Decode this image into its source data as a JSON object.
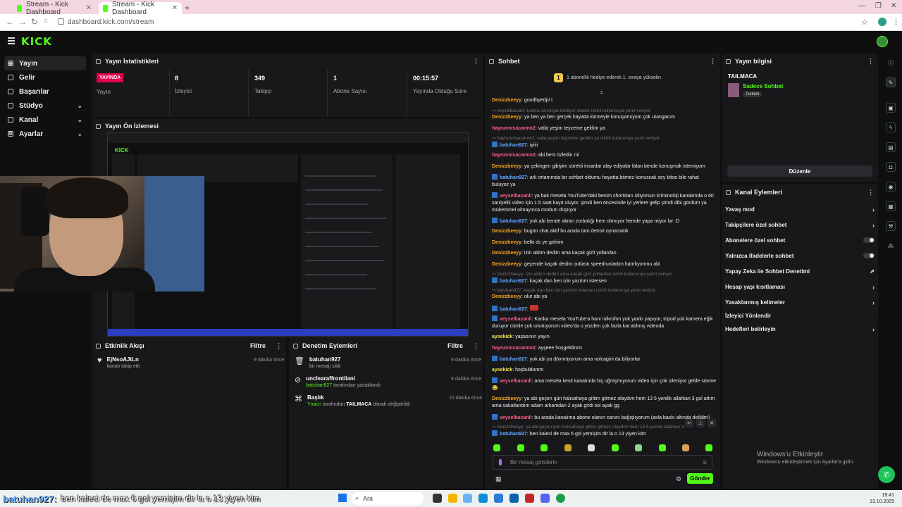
{
  "browser": {
    "tabs": [
      {
        "title": "Stream - Kick Dashboard"
      },
      {
        "title": "Stream - Kick Dashboard"
      }
    ],
    "url": "dashboard.kick.com/stream"
  },
  "app": {
    "logo": "KICK"
  },
  "sidebar": {
    "items": [
      {
        "label": "Yayın",
        "icon": "broadcast-icon"
      },
      {
        "label": "Gelir",
        "icon": "wallet-icon"
      },
      {
        "label": "Başarılar",
        "icon": "trophy-icon"
      },
      {
        "label": "Stüdyo",
        "icon": "studio-icon"
      },
      {
        "label": "Kanal",
        "icon": "channel-icon"
      },
      {
        "label": "Ayarlar",
        "icon": "gear-icon"
      }
    ]
  },
  "stats": {
    "title": "Yayın İstatistikleri",
    "live_badge": "YAYINDA",
    "live_label": "Yayın",
    "viewers": {
      "value": "8",
      "label": "İzleyici"
    },
    "followers": {
      "value": "349",
      "label": "Takipçi"
    },
    "subs": {
      "value": "1",
      "label": "Abone Sayısı"
    },
    "uptime": {
      "value": "00:15:57",
      "label": "Yayında Olduğu Süre"
    }
  },
  "preview": {
    "title": "Yayın Ön İzlemesi"
  },
  "events": {
    "title": "Etkinlik Akışı",
    "filter": "Filtre",
    "items": [
      {
        "name": "EjNsoAJtLn",
        "sub": "kanalı takip etti",
        "time": "9 dakika önce"
      }
    ]
  },
  "moderation": {
    "title": "Denetim Eylemleri",
    "filter": "Filtre",
    "items": [
      {
        "name": "batuhan927",
        "sub": "bir mesajı sildi",
        "time": "9 dakika önce"
      },
      {
        "name": "unclearaffrontiiani",
        "sub_user": "batuhan927",
        "sub": "tarafından yasaklandı",
        "time": "9 dakika önce"
      },
      {
        "name": "Başlık",
        "sub_user": "Ynacn",
        "sub_mid": "tarafından",
        "sub_tag": "TAILMACA",
        "sub": "olarak değiştirildi",
        "time": "15 dakika önce"
      }
    ]
  },
  "chat": {
    "title": "Sohbet",
    "gift_banner": "1 abonelik hediye ederek 1. sıraya yükselin",
    "messages": [
      {
        "user": "Denizzbeeyy",
        "text": "goodbyedpi t",
        "color": "u-or"
      },
      {
        "reply": "↪ veyselbacanli: kanka sıkıntıyla etkiliyor olabilir isimli kullanıcıya yanıt veriyor"
      },
      {
        "user": "Denizzbeeyy",
        "text": "ya ben ya ben gerçek hayatta kimseyle konuşamıyom çok utangacım",
        "color": "u-or"
      },
      {
        "user": "hayrunnisacannn2",
        "text": "valla yeşim teyzeme geldim ya",
        "color": "u-pk"
      },
      {
        "reply": "↪ hayrunnisacannn2: valla yeşim teyzeme geldim ya isimli kullanıcıya yanıt veriyor"
      },
      {
        "user": "batuhan927",
        "text": "iyiiii",
        "color": "u-bl",
        "badge": true
      },
      {
        "user": "hayrunnisacannn2",
        "text": "abi beni özledin mi",
        "color": "u-pk"
      },
      {
        "user": "Denizzbeeyy",
        "text": "ya çekingen gibiyim sürekli insanlar alay ediyolar falan bende konuşmak istemiyom",
        "color": "u-or"
      },
      {
        "user": "batuhan927",
        "text": "ark ortamında bir sohbet oldumu hayatta bitmez konuscak sey bitse bile rahat buluyoz ya",
        "color": "u-bl",
        "badge": true
      },
      {
        "user": "veyselbacanli",
        "text": "ya bak mesela YouTube'daki benim shortsları izliyorsun kriminoloji kanalımda o 60 saniyelik video için 1.5 saat kayıt oluyor. şimdi ben öncesinde iyi yerlere gelip şimdi dibi gördüm ya mükemmel olmayınca modum düşüyor",
        "color": "u-pk",
        "badge": true
      },
      {
        "user": "batuhan927",
        "text": "yok abi bende akran zorbalığı hem olmuyor hemde yapa miyor lar :D",
        "color": "u-bl",
        "badge": true
      },
      {
        "user": "Denizzbeeyy",
        "text": "bugün chat aktif bu arada tam detroit oynamalık",
        "color": "u-or"
      },
      {
        "user": "Denizzbeeyy",
        "text": "belki dc ye gelirim",
        "color": "u-or"
      },
      {
        "user": "Denizzbeeyy",
        "text": "izin aldım dedim ama kaçak gizli yollardan",
        "color": "u-or"
      },
      {
        "user": "Denizzbeeyy",
        "text": "geçende kaçak dedim outlastı speedrunladım hatırlıyonmu abi",
        "color": "u-or"
      },
      {
        "reply": "↪ Denizzbeeyy: izin aldım dedim ama kaçak gizli yollardan isimli kullanıcıya yanıt veriyor"
      },
      {
        "user": "batuhan927",
        "text": "kaçak dan ben izin yazıtım istersen",
        "color": "u-bl",
        "badge": true
      },
      {
        "reply": "↪ batuhan927: kaçak dan ben izin yazıtım istersen isimli kullanıcıya yanıt veriyor"
      },
      {
        "user": "Denizzbeeyy",
        "text": "olur abi ya",
        "color": "u-or"
      },
      {
        "user": "batuhan927",
        "text": "",
        "color": "u-bl",
        "badge": true
      },
      {
        "user": "veyselbacanli",
        "text": "Kanka mesela YouTube'a hani mikrofon yok yankı yapıyor, tripod yok kamera eğik duruyor cümle çok unutuyorum video'da o yüzden çok fazla kat atılmış videoda",
        "color": "u-pk",
        "badge": true
      },
      {
        "user": "aysekick",
        "text": "yaşasının yayın",
        "color": "u-yl"
      },
      {
        "user": "hayrunnisacannn2",
        "text": "ayşeee hoşgeldinnn",
        "color": "u-pk"
      },
      {
        "user": "batuhan927",
        "text": "yok abi ya dövmüyorum ama nolcagini da biliyorlar",
        "color": "u-bl",
        "badge": true
      },
      {
        "user": "aysekick",
        "text": "hoşbuldumm",
        "color": "u-yl"
      },
      {
        "user": "veyselbacanli",
        "text": "ama mesela kesit kanalında hiç uğraşmıyorum video için çok izleniyor gelde sövme 😂",
        "color": "u-pk",
        "badge": true
      },
      {
        "user": "Denizzbeeyy",
        "text": "ya abi geçen gün halısahaya gittim gitmez olaydım hem 13 5 yenilik allahtan 3 gol attım ama sakatlandım adam arkamdan 2 ayak girdi sol ayak gg",
        "color": "u-or"
      },
      {
        "user": "veyselbacanli",
        "text": "bu arada kanalıma abone olanın canını bağışlıyorum (asla baskı altında değilim)",
        "color": "u-pk",
        "badge": true
      },
      {
        "reply": "↪ Denizzbeeyy: ya abi geçen gün halısahaya gittim gitmez olaydım hem 13 5 yenilik allahtan 3"
      },
      {
        "user": "batuhan927",
        "text": "ben kaleci de max 6 gol yemişim dir la o 13 yiyen kim",
        "color": "u-bl",
        "badge": true
      }
    ],
    "input_placeholder": "Bir mesaj gönderin",
    "send_label": "Gönder"
  },
  "stream_info": {
    "title": "Yayın bilgisi",
    "stream_title": "TAILMACA",
    "category": "Sadece Sohbet",
    "language": "Turkish",
    "edit_label": "Düzenle"
  },
  "channel_actions": {
    "title": "Kanal Eylemleri",
    "items": [
      {
        "label": "Yavaş mod",
        "control": "chevron"
      },
      {
        "label": "Takipçilere özel sohbet",
        "control": "chevron"
      },
      {
        "label": "Abonelere özel sohbet",
        "control": "toggle"
      },
      {
        "label": "Yalnızca ifadelerle sohbet",
        "control": "toggle"
      },
      {
        "label": "Yapay Zeka ile Sohbet Denetimi",
        "control": "external"
      },
      {
        "label": "Hesap yaşı kısıtlaması",
        "control": "chevron"
      },
      {
        "label": "Yasaklanmış kelimeler",
        "control": "chevron"
      },
      {
        "label": "İzleyici Yönlendir",
        "control": "none"
      },
      {
        "label": "Hedefleri belirleyin",
        "control": "chevron"
      }
    ]
  },
  "overlay_ticker": {
    "user": "batuhan927:",
    "text": "ben kaleci de max 6 gol yemişim dir la o 13 yiyen kim"
  },
  "windows": {
    "activate_title": "Windows'u Etkinleştir",
    "activate_sub": "Windows'u etkinleştirmek için Ayarlar'a gidin.",
    "search": "Ara",
    "time": "19:41",
    "date": "13.10.2025"
  },
  "colors": {
    "accent": "#53fc18",
    "live": "#e2004a",
    "panel": "#18181b"
  }
}
